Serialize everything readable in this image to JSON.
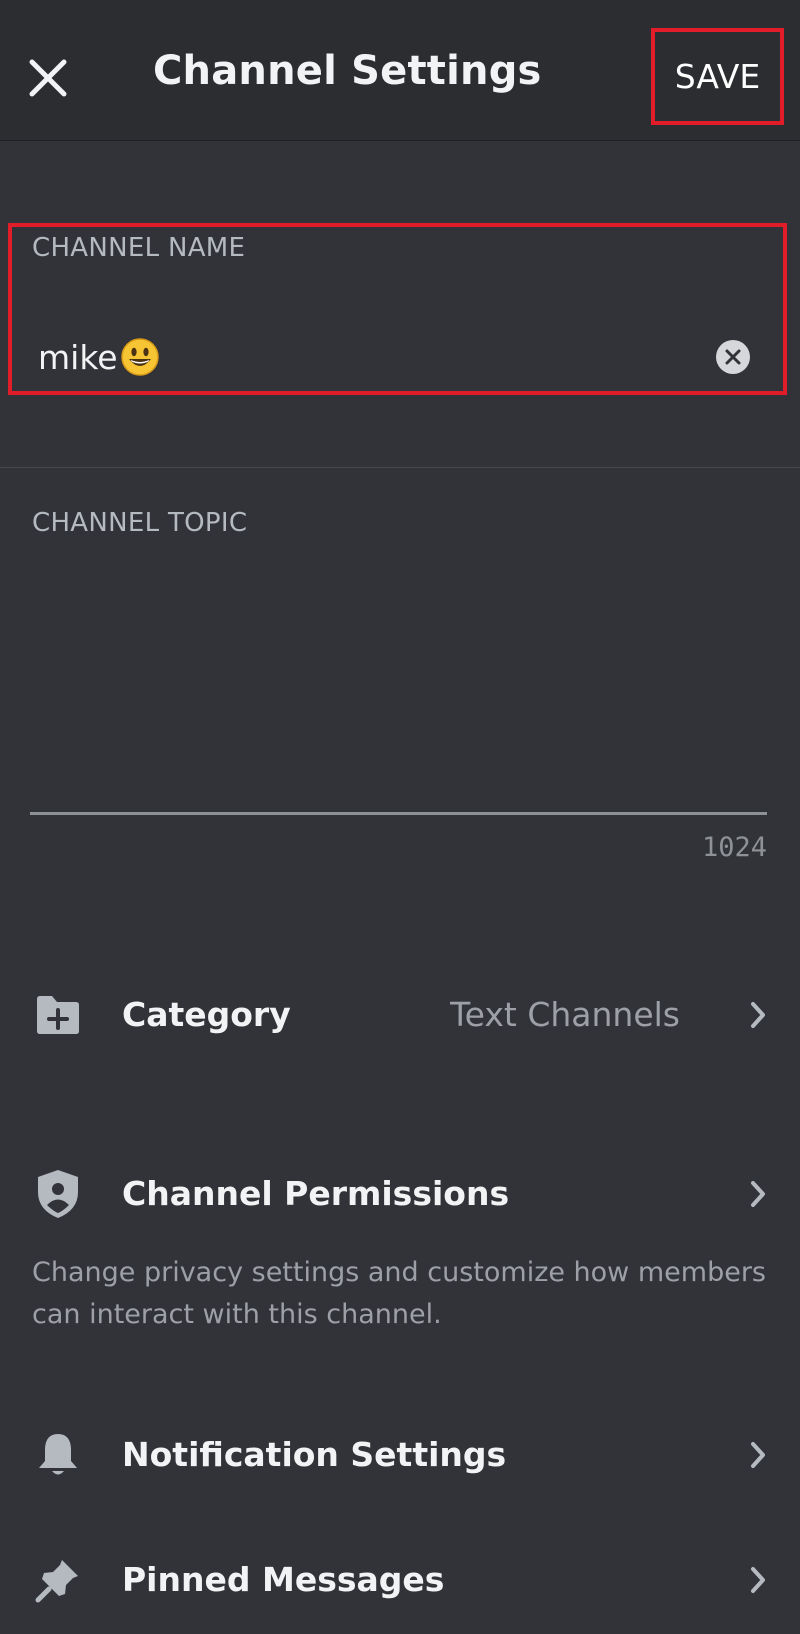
{
  "header": {
    "title": "Channel Settings",
    "close_icon": "close-icon",
    "save_label": "SAVE"
  },
  "channel_name": {
    "label": "CHANNEL NAME",
    "value": "mike",
    "emoji": "smiling-face-emoji",
    "clear_icon": "clear-circle-icon"
  },
  "channel_topic": {
    "label": "CHANNEL TOPIC",
    "value": "",
    "char_remaining": "1024"
  },
  "settings": {
    "category": {
      "label": "Category",
      "value": "Text Channels",
      "icon": "folder-plus-icon"
    },
    "permissions": {
      "label": "Channel Permissions",
      "description": "Change privacy settings and customize how members can interact with this channel.",
      "icon": "shield-user-icon"
    },
    "notifications": {
      "label": "Notification Settings",
      "icon": "bell-icon"
    },
    "pinned": {
      "label": "Pinned Messages",
      "icon": "pin-icon"
    }
  },
  "colors": {
    "background": "#313338",
    "header_background": "#2b2d31",
    "highlight_border": "#e11d2a",
    "text_primary": "#f2f3f5",
    "text_muted": "#9da0a6"
  }
}
